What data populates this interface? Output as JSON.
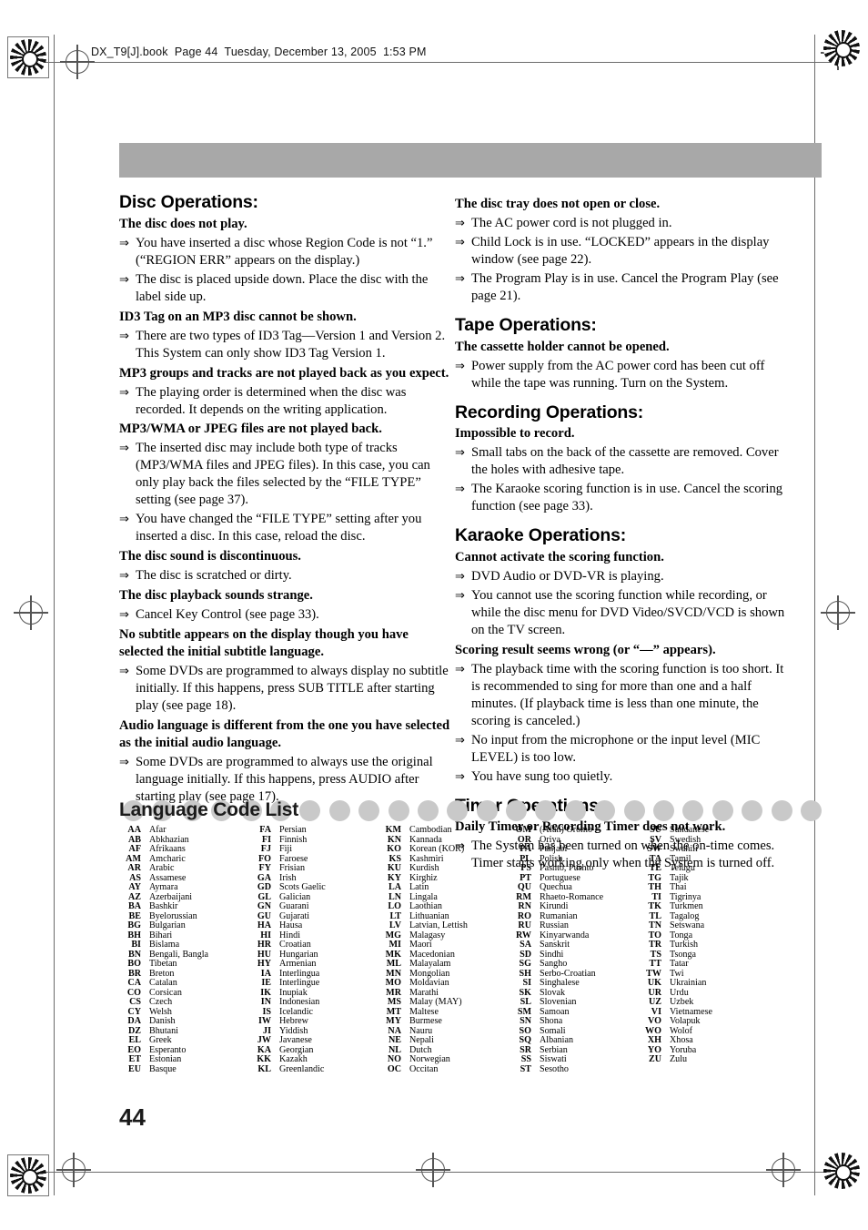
{
  "header": {
    "file_line": "DX_T9[J].book  Page 44  Tuesday, December 13, 2005  1:53 PM"
  },
  "page_number": "44",
  "arrow_glyph": "⇒",
  "colors": {
    "top_bar": "#a8a8a8",
    "banner_dot": "#c9c9c9",
    "text": "#000000"
  },
  "left_column": {
    "sections": [
      {
        "title": "Disc Operations:",
        "entries": [
          {
            "question": "The disc does not play.",
            "answers": [
              "You have inserted a disc whose Region Code is not “1.” (“REGION ERR” appears on the display.)",
              "The disc is placed upside down. Place the disc with the label side up."
            ]
          },
          {
            "question": "ID3 Tag on an MP3 disc cannot be shown.",
            "answers": [
              "There are two types of ID3 Tag—Version 1 and Version 2. This System can only show ID3 Tag Version 1."
            ]
          },
          {
            "question": "MP3 groups and tracks are not played back as you expect.",
            "answers": [
              "The playing order is determined when the disc was recorded. It depends on the writing application."
            ]
          },
          {
            "question": "MP3/WMA or JPEG files are not played back.",
            "answers": [
              "The inserted disc may include both type of tracks (MP3/WMA files and JPEG files). In this case, you can only play back the files selected by the “FILE TYPE” setting (see page 37).",
              "You have changed the “FILE TYPE” setting after you inserted a disc. In this case, reload the disc."
            ]
          },
          {
            "question": "The disc sound is discontinuous.",
            "answers": [
              "The disc is scratched or dirty."
            ]
          },
          {
            "question": "The disc playback sounds strange.",
            "answers": [
              "Cancel Key Control (see page 33)."
            ]
          },
          {
            "question": "No subtitle appears on the display though you have selected the initial subtitle language.",
            "answers": [
              "Some DVDs are programmed to always display no subtitle initially. If this happens, press SUB TITLE after starting play (see page 18)."
            ]
          },
          {
            "question": "Audio language is different from the one you have selected as the initial audio language.",
            "answers": [
              "Some DVDs are programmed to always use the original language initially. If this happens, press AUDIO after starting play (see page 17)."
            ]
          }
        ]
      }
    ]
  },
  "right_column": {
    "sections": [
      {
        "title": "",
        "entries": [
          {
            "question": "The disc tray does not open or close.",
            "answers": [
              "The AC power cord is not plugged in.",
              "Child Lock is in use. “LOCKED” appears in the display window (see page 22).",
              "The Program Play is in use. Cancel the Program Play (see page 21)."
            ]
          }
        ]
      },
      {
        "title": "Tape Operations:",
        "entries": [
          {
            "question": "The cassette holder cannot be opened.",
            "answers": [
              "Power supply from the AC power cord has been cut off while the tape was running. Turn on the System."
            ]
          }
        ]
      },
      {
        "title": "Recording Operations:",
        "entries": [
          {
            "question": "Impossible to record.",
            "answers": [
              "Small tabs on the back of the cassette are removed. Cover the holes with adhesive tape.",
              "The Karaoke scoring function is in use. Cancel the scoring function (see page 33)."
            ]
          }
        ]
      },
      {
        "title": "Karaoke Operations:",
        "entries": [
          {
            "question": "Cannot activate the scoring function.",
            "answers": [
              "DVD Audio or DVD-VR is playing.",
              "You cannot use the scoring function while recording, or while the disc menu for DVD Video/SVCD/VCD is shown on the TV screen."
            ]
          },
          {
            "question": "Scoring result seems wrong (or “––” appears).",
            "answers": [
              "The playback time with the scoring function is too short. It is recommended to sing for more than one and a half minutes. (If playback time is less than one minute, the scoring is canceled.)",
              "No input from the microphone or the input level (MIC LEVEL) is too low.",
              "You have sung too quietly."
            ]
          }
        ]
      },
      {
        "title": "Timer Operations:",
        "entries": [
          {
            "question": "Daily Timer or Recording Timer does not work.",
            "answers": [
              "The System has been turned on when the on-time comes. Timer starts working only when the System is turned off."
            ]
          }
        ]
      }
    ]
  },
  "language_section": {
    "banner_title": "Language Code List",
    "dot_count": 25,
    "columns": [
      [
        [
          "AA",
          "Afar"
        ],
        [
          "AB",
          "Abkhazian"
        ],
        [
          "AF",
          "Afrikaans"
        ],
        [
          "AM",
          "Amcharic"
        ],
        [
          "AR",
          "Arabic"
        ],
        [
          "AS",
          "Assamese"
        ],
        [
          "AY",
          "Aymara"
        ],
        [
          "AZ",
          "Azerbaijani"
        ],
        [
          "BA",
          "Bashkir"
        ],
        [
          "BE",
          "Byelorussian"
        ],
        [
          "BG",
          "Bulgarian"
        ],
        [
          "BH",
          "Bihari"
        ],
        [
          "BI",
          "Bislama"
        ],
        [
          "BN",
          "Bengali, Bangla"
        ],
        [
          "BO",
          "Tibetan"
        ],
        [
          "BR",
          "Breton"
        ],
        [
          "CA",
          "Catalan"
        ],
        [
          "CO",
          "Corsican"
        ],
        [
          "CS",
          "Czech"
        ],
        [
          "CY",
          "Welsh"
        ],
        [
          "DA",
          "Danish"
        ],
        [
          "DZ",
          "Bhutani"
        ],
        [
          "EL",
          "Greek"
        ],
        [
          "EO",
          "Esperanto"
        ],
        [
          "ET",
          "Estonian"
        ],
        [
          "EU",
          "Basque"
        ]
      ],
      [
        [
          "FA",
          "Persian"
        ],
        [
          "FI",
          "Finnish"
        ],
        [
          "FJ",
          "Fiji"
        ],
        [
          "FO",
          "Faroese"
        ],
        [
          "FY",
          "Frisian"
        ],
        [
          "GA",
          "Irish"
        ],
        [
          "GD",
          "Scots Gaelic"
        ],
        [
          "GL",
          "Galician"
        ],
        [
          "GN",
          "Guarani"
        ],
        [
          "GU",
          "Gujarati"
        ],
        [
          "HA",
          "Hausa"
        ],
        [
          "HI",
          "Hindi"
        ],
        [
          "HR",
          "Croatian"
        ],
        [
          "HU",
          "Hungarian"
        ],
        [
          "HY",
          "Armenian"
        ],
        [
          "IA",
          "Interlingua"
        ],
        [
          "IE",
          "Interlingue"
        ],
        [
          "IK",
          "Inupiak"
        ],
        [
          "IN",
          "Indonesian"
        ],
        [
          "IS",
          "Icelandic"
        ],
        [
          "IW",
          "Hebrew"
        ],
        [
          "JI",
          "Yiddish"
        ],
        [
          "JW",
          "Javanese"
        ],
        [
          "KA",
          "Georgian"
        ],
        [
          "KK",
          "Kazakh"
        ],
        [
          "KL",
          "Greenlandic"
        ]
      ],
      [
        [
          "KM",
          "Cambodian"
        ],
        [
          "KN",
          "Kannada"
        ],
        [
          "KO",
          "Korean (KOR)"
        ],
        [
          "KS",
          "Kashmiri"
        ],
        [
          "KU",
          "Kurdish"
        ],
        [
          "KY",
          "Kirghiz"
        ],
        [
          "LA",
          "Latin"
        ],
        [
          "LN",
          "Lingala"
        ],
        [
          "LO",
          "Laothian"
        ],
        [
          "LT",
          "Lithuanian"
        ],
        [
          "LV",
          "Latvian, Lettish"
        ],
        [
          "MG",
          "Malagasy"
        ],
        [
          "MI",
          "Maori"
        ],
        [
          "MK",
          "Macedonian"
        ],
        [
          "ML",
          "Malayalam"
        ],
        [
          "MN",
          "Mongolian"
        ],
        [
          "MO",
          "Moldavian"
        ],
        [
          "MR",
          "Marathi"
        ],
        [
          "MS",
          "Malay (MAY)"
        ],
        [
          "MT",
          "Maltese"
        ],
        [
          "MY",
          "Burmese"
        ],
        [
          "NA",
          "Nauru"
        ],
        [
          "NE",
          "Nepali"
        ],
        [
          "NL",
          "Dutch"
        ],
        [
          "NO",
          "Norwegian"
        ],
        [
          "OC",
          "Occitan"
        ]
      ],
      [
        [
          "OM",
          "(Afan) Oromo"
        ],
        [
          "OR",
          "Oriya"
        ],
        [
          "PA",
          "Panjabi"
        ],
        [
          "PL",
          "Polish"
        ],
        [
          "PS",
          "Pashto, Pushto"
        ],
        [
          "PT",
          "Portuguese"
        ],
        [
          "QU",
          "Quechua"
        ],
        [
          "RM",
          "Rhaeto-Romance"
        ],
        [
          "RN",
          "Kirundi"
        ],
        [
          "RO",
          "Rumanian"
        ],
        [
          "RU",
          "Russian"
        ],
        [
          "RW",
          "Kinyarwanda"
        ],
        [
          "SA",
          "Sanskrit"
        ],
        [
          "SD",
          "Sindhi"
        ],
        [
          "SG",
          "Sangho"
        ],
        [
          "SH",
          "Serbo-Croatian"
        ],
        [
          "SI",
          "Singhalese"
        ],
        [
          "SK",
          "Slovak"
        ],
        [
          "SL",
          "Slovenian"
        ],
        [
          "SM",
          "Samoan"
        ],
        [
          "SN",
          "Shona"
        ],
        [
          "SO",
          "Somali"
        ],
        [
          "SQ",
          "Albanian"
        ],
        [
          "SR",
          "Serbian"
        ],
        [
          "SS",
          "Siswati"
        ],
        [
          "ST",
          "Sesotho"
        ]
      ],
      [
        [
          "SU",
          "Sundanese"
        ],
        [
          "SV",
          "Swedish"
        ],
        [
          "SW",
          "Swahili"
        ],
        [
          "TA",
          "Tamil"
        ],
        [
          "TE",
          "Telugu"
        ],
        [
          "TG",
          "Tajik"
        ],
        [
          "TH",
          "Thai"
        ],
        [
          "TI",
          "Tigrinya"
        ],
        [
          "TK",
          "Turkmen"
        ],
        [
          "TL",
          "Tagalog"
        ],
        [
          "TN",
          "Setswana"
        ],
        [
          "TO",
          "Tonga"
        ],
        [
          "TR",
          "Turkish"
        ],
        [
          "TS",
          "Tsonga"
        ],
        [
          "TT",
          "Tatar"
        ],
        [
          "TW",
          "Twi"
        ],
        [
          "UK",
          "Ukrainian"
        ],
        [
          "UR",
          "Urdu"
        ],
        [
          "UZ",
          "Uzbek"
        ],
        [
          "VI",
          "Vietnamese"
        ],
        [
          "VO",
          "Volapuk"
        ],
        [
          "WO",
          "Wolof"
        ],
        [
          "XH",
          "Xhosa"
        ],
        [
          "YO",
          "Yoruba"
        ],
        [
          "ZU",
          "Zulu"
        ]
      ]
    ]
  }
}
